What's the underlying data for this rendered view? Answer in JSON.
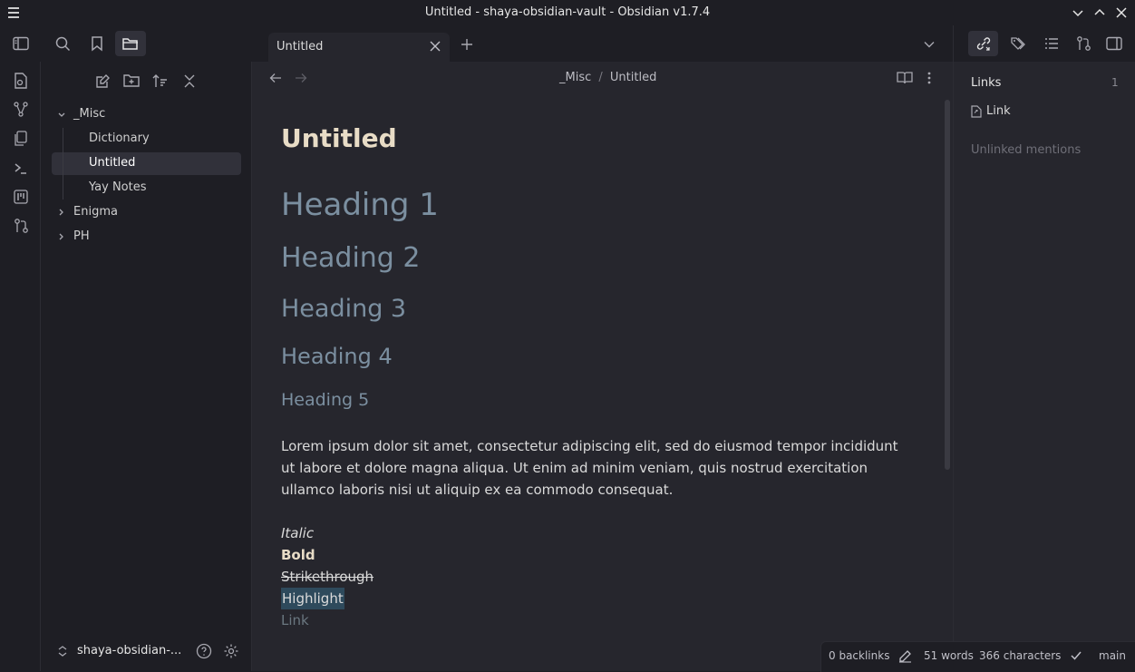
{
  "window": {
    "title": "Untitled - shaya-obsidian-vault - Obsidian v1.7.4"
  },
  "tabs": [
    {
      "label": "Untitled"
    }
  ],
  "breadcrumb": {
    "folder": "_Misc",
    "separator": "/",
    "file": "Untitled"
  },
  "file_tree": {
    "folders": [
      {
        "label": "_Misc",
        "expanded": true,
        "children": [
          "Dictionary",
          "Untitled",
          "Yay Notes"
        ]
      },
      {
        "label": "Enigma",
        "expanded": false
      },
      {
        "label": "PH",
        "expanded": false
      }
    ],
    "selected": "Untitled"
  },
  "vault": {
    "name": "shaya-obsidian-..."
  },
  "note": {
    "title": "Untitled",
    "headings": [
      "Heading 1",
      "Heading 2",
      "Heading 3",
      "Heading 4",
      "Heading 5"
    ],
    "paragraph_lines": [
      "Lorem ipsum dolor sit amet, consectetur adipiscing elit, sed do eiusmod tempor incididunt",
      "ut labore et dolore magna aliqua. Ut enim ad minim veniam, quis nostrud exercitation",
      "ullamco laboris nisi ut aliquip ex ea commodo consequat."
    ],
    "italic": "Italic",
    "bold": "Bold",
    "strikethrough": "Strikethrough",
    "highlight": "Highlight",
    "link": "Link"
  },
  "links_panel": {
    "title": "Links",
    "count": "1",
    "items": [
      "Link"
    ],
    "unlinked": "Unlinked mentions"
  },
  "status": {
    "backlinks": "0 backlinks",
    "words": "51 words",
    "characters": "366 characters",
    "branch": "main"
  },
  "colors": {
    "background": "#1e1e24",
    "editor_bg": "#26262d",
    "heading": "#7b8fa0",
    "highlight_bg": "#2e4a5c",
    "link_text": "#6a7780"
  }
}
